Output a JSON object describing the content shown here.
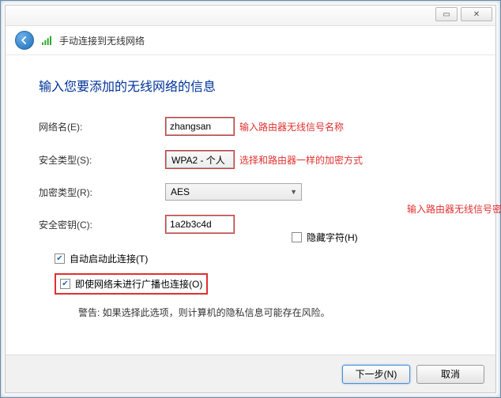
{
  "titlebar": {
    "minimize_glyph": "▭",
    "close_glyph": "✕"
  },
  "header": {
    "title": "手动连接到无线网络"
  },
  "page": {
    "title": "输入您要添加的无线网络的信息"
  },
  "form": {
    "network_name": {
      "label": "网络名(E):",
      "value": "zhangsan"
    },
    "security_type": {
      "label": "安全类型(S):",
      "value": "WPA2 - 个人"
    },
    "encryption_type": {
      "label": "加密类型(R):",
      "value": "AES"
    },
    "security_key": {
      "label": "安全密钥(C):",
      "value": "1a2b3c4d"
    },
    "hide_chars": {
      "label": "隐藏字符(H)",
      "checked": false
    },
    "auto_start": {
      "label": "自动启动此连接(T)",
      "checked": true
    },
    "connect_hidden": {
      "label": "即使网络未进行广播也连接(O)",
      "checked": true
    },
    "warning": "警告: 如果选择此选项，则计算机的隐私信息可能存在风险。"
  },
  "annotations": {
    "network_name": "输入路由器无线信号名称",
    "security_type": "选择和路由器一样的加密方式",
    "security_key": "输入路由器无线信号密码"
  },
  "footer": {
    "next": "下一步(N)",
    "cancel": "取消"
  }
}
